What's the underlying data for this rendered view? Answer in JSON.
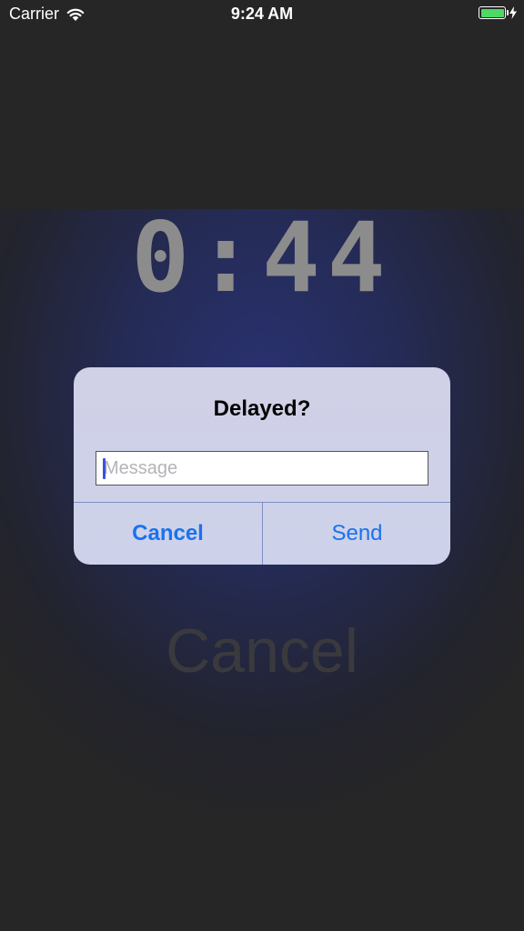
{
  "status_bar": {
    "carrier": "Carrier",
    "time": "9:24 AM",
    "battery_color": "#4cd964"
  },
  "timer": {
    "display": "0:44"
  },
  "background": {
    "cancel_label": "Cancel"
  },
  "alert": {
    "title": "Delayed?",
    "input_value": "",
    "input_placeholder": "Message",
    "cancel_label": "Cancel",
    "send_label": "Send",
    "button_color": "#1a72f0"
  }
}
